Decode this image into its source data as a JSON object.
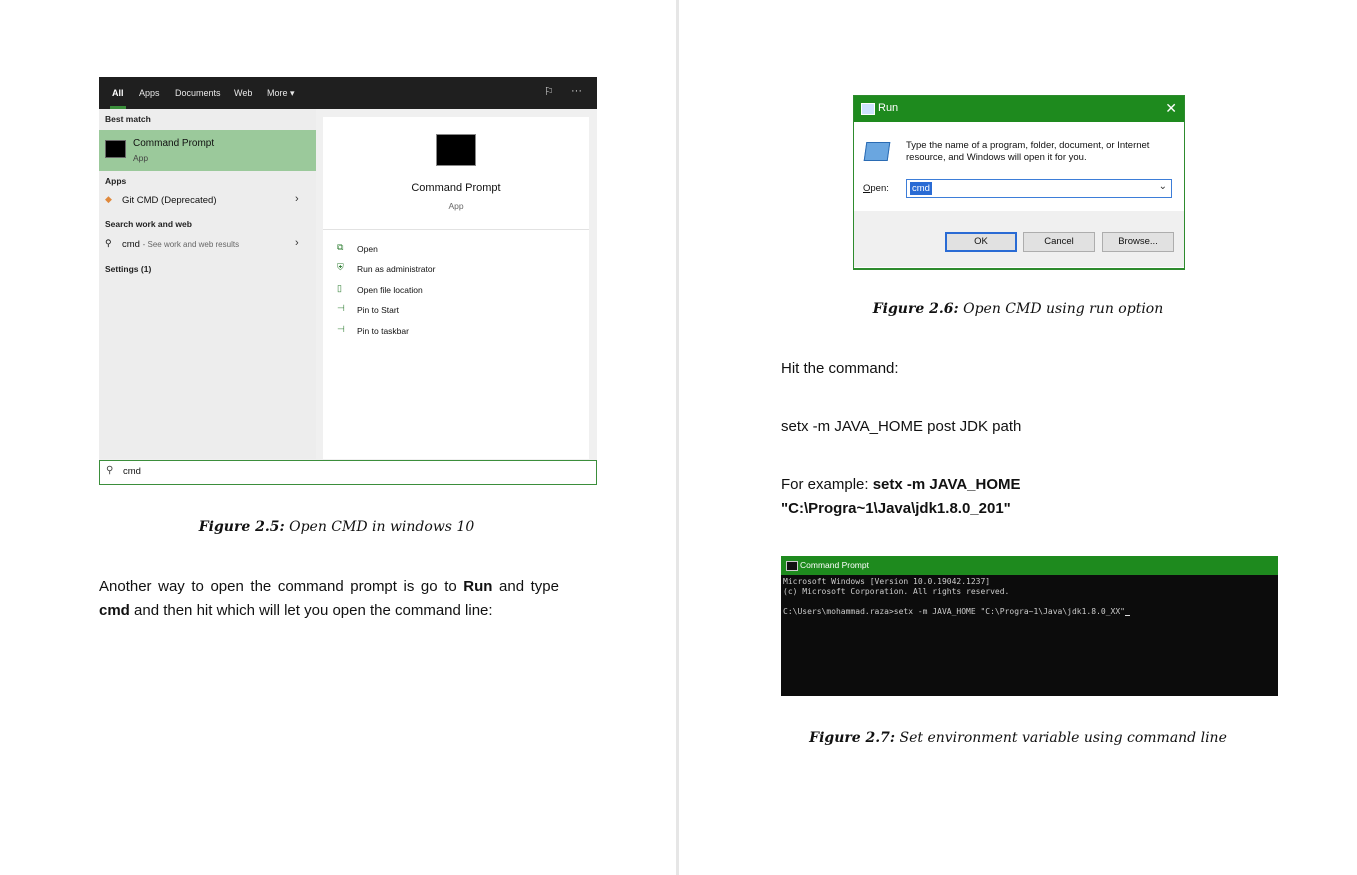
{
  "left_page": {
    "search_window": {
      "tabs": [
        "All",
        "Apps",
        "Documents",
        "Web",
        "More"
      ],
      "active_tab": "All",
      "best_match_heading": "Best match",
      "best_match": {
        "name": "Command Prompt",
        "sub": "App"
      },
      "apps_heading": "Apps",
      "apps": [
        {
          "name": "Git CMD (Deprecated)"
        }
      ],
      "search_heading": "Search work and web",
      "search_result": {
        "term": "cmd",
        "sub": "- See work and web results"
      },
      "settings_heading": "Settings (1)",
      "preview": {
        "name": "Command Prompt",
        "sub": "App"
      },
      "actions": [
        "Open",
        "Run as administrator",
        "Open file location",
        "Pin to Start",
        "Pin to taskbar"
      ],
      "search_value": "cmd"
    },
    "figure_caption": {
      "label": "Figure 2.5:",
      "text": "Open CMD in windows 10"
    },
    "paragraph": {
      "part1": "Another way to open the command prompt is go to ",
      "run": "Run",
      "part2": " and type ",
      "cmd": "cmd",
      "part3": " and then hit which will let you open the command line:"
    }
  },
  "right_page": {
    "run_dialog": {
      "title": "Run",
      "description": "Type the name of a program, folder, document, or Internet resource, and Windows will open it for you.",
      "open_label_u": "O",
      "open_label_rest": "pen:",
      "input_value": "cmd",
      "ok_label": "OK",
      "cancel_label": "Cancel",
      "browse_label": "Browse..."
    },
    "figure_caption_1": {
      "label": "Figure 2.6:",
      "text": "Open CMD using run option"
    },
    "hit_command": "Hit the command:",
    "command_line": "setx -m JAVA_HOME post JDK path",
    "example_label": "For example: ",
    "example_cmd_1": "setx -m JAVA_HOME",
    "example_cmd_2": "\"C:\\Progra~1\\Java\\jdk1.8.0_201\"",
    "cmd_window": {
      "title": "Command Prompt",
      "lines": [
        "Microsoft Windows [Version 10.0.19042.1237]",
        "(c) Microsoft Corporation. All rights reserved.",
        "",
        "C:\\Users\\mohammad.raza>setx -m JAVA_HOME \"C:\\Progra~1\\Java\\jdk1.8.0_XX\""
      ]
    },
    "figure_caption_2": {
      "label": "Figure 2.7:",
      "text": "Set environment variable using command line"
    }
  }
}
